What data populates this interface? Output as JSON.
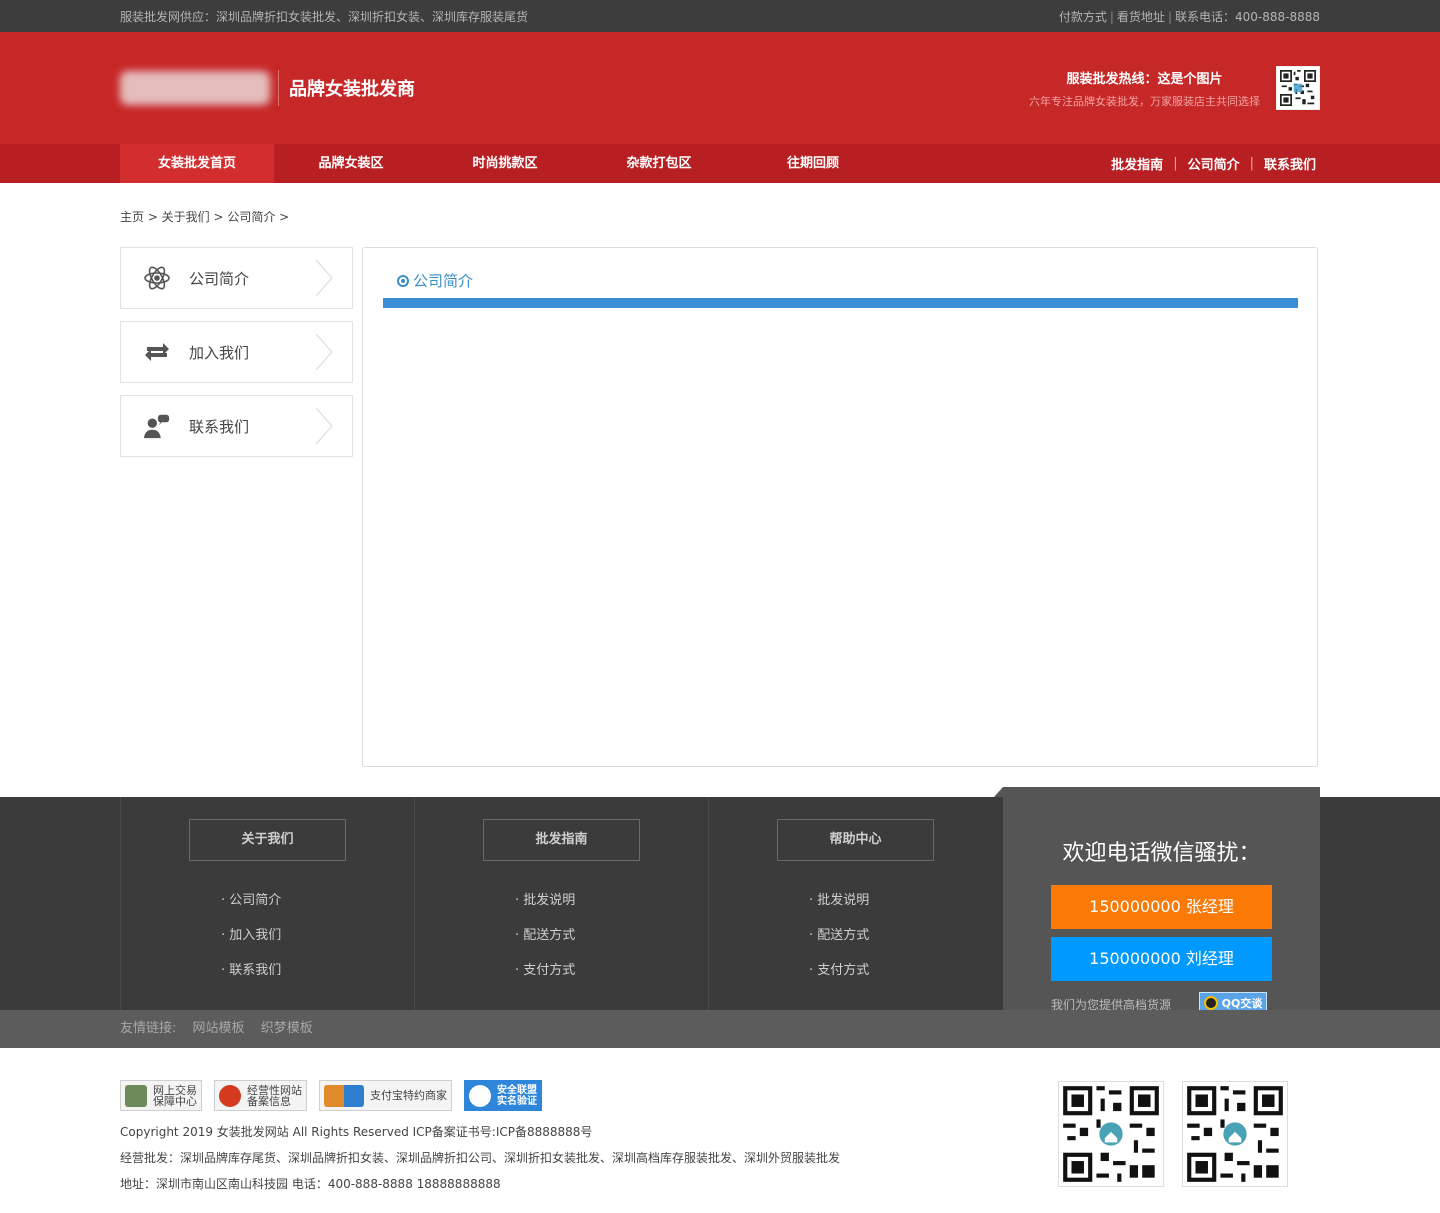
{
  "topbar": {
    "notice": "服装批发网供应：深圳品牌折扣女装批发、深圳折扣女装、深圳库存服装尾货",
    "links": [
      "付款方式",
      "看货地址",
      "联系电话：400-888-8888"
    ]
  },
  "header": {
    "brand_name": "品牌女装批发商",
    "hotline_title": "服装批发热线：这是个图片",
    "hotline_sub": "六年专注品牌女装批发，万家服装店主共同选择"
  },
  "nav": {
    "items": [
      "女装批发首页",
      "品牌女装区",
      "时尚挑款区",
      "杂款打包区",
      "往期回顾"
    ],
    "right": [
      "批发指南",
      "公司简介",
      "联系我们"
    ]
  },
  "breadcrumb": "主页 > 关于我们 > 公司简介 >",
  "sidebar": {
    "items": [
      {
        "label": "公司简介",
        "icon": "atom-icon"
      },
      {
        "label": "加入我们",
        "icon": "exchange-icon"
      },
      {
        "label": "联系我们",
        "icon": "contact-person-icon"
      }
    ]
  },
  "main": {
    "title": "公司简介"
  },
  "footer": {
    "columns": [
      {
        "title": "关于我们",
        "items": [
          "公司简介",
          "加入我们",
          "联系我们"
        ]
      },
      {
        "title": "批发指南",
        "items": [
          "批发说明",
          "配送方式",
          "支付方式"
        ]
      },
      {
        "title": "帮助中心",
        "items": [
          "批发说明",
          "配送方式",
          "支付方式"
        ]
      }
    ],
    "contact": {
      "title": "欢迎电话微信骚扰：",
      "btn1": "150000000 张经理",
      "btn2": "150000000 刘经理",
      "note": "我们为您提供高档货源",
      "qq_label": "QQ交谈"
    },
    "links": {
      "label": "友情链接:",
      "items": [
        "网站模板",
        "织梦模板"
      ]
    }
  },
  "bottom": {
    "badges": [
      {
        "l1": "网上交易",
        "l2": "保障中心"
      },
      {
        "l1": "经营性网站",
        "l2": "备案信息"
      },
      {
        "l1": "支付宝特约商家",
        "l2": ""
      },
      {
        "l1": "安全联盟",
        "l2": "实名验证"
      }
    ],
    "copyright": "Copyright 2019 女装批发网站 All Rights Reserved ICP备案证书号:ICP备8888888号",
    "business": "经营批发：深圳品牌库存尾货、深圳品牌折扣女装、深圳品牌折扣公司、深圳折扣女装批发、深圳高档库存服装批发、深圳外贸服装批发",
    "address": "地址：深圳市南山区南山科技园 电话：400-888-8888 18888888888"
  },
  "colors": {
    "brand_red": "#c62828",
    "nav_red": "#b71f23",
    "accent_blue": "#3a8fd6",
    "btn_orange": "#fb7a05",
    "btn_blue": "#0099ff"
  }
}
